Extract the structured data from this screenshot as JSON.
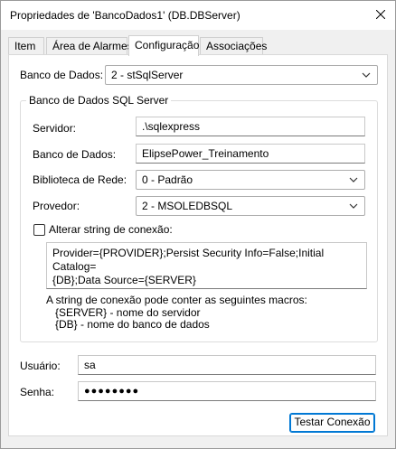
{
  "window": {
    "title": "Propriedades de 'BancoDados1' (DB.DBServer)"
  },
  "tabs": [
    {
      "label": "Item"
    },
    {
      "label": "Área de Alarmes"
    },
    {
      "label": "Configuração"
    },
    {
      "label": "Associações"
    }
  ],
  "active_tab": "Configuração",
  "form": {
    "database_label": "Banco de Dados:",
    "database_value": "2 - stSqlServer",
    "group_title": "Banco de Dados SQL Server",
    "server_label": "Servidor:",
    "server_value": ".\\sqlexpress",
    "dbname_label": "Banco de Dados:",
    "dbname_value": "ElipsePower_Treinamento",
    "netlib_label": "Biblioteca de Rede:",
    "netlib_value": "0 - Padrão",
    "provider_label": "Provedor:",
    "provider_value": "2 - MSOLEDBSQL",
    "alter_conn_label": "Alterar string de conexão:",
    "alter_conn_checked": false,
    "conn_string_line1": "Provider={PROVIDER};Persist Security Info=False;Initial Catalog=",
    "conn_string_line2": "{DB};Data Source={SERVER}",
    "macros_intro": "A string de conexão pode conter as seguintes macros:",
    "macro_server": "{SERVER} - nome do servidor",
    "macro_db": "{DB} - nome do banco de dados",
    "user_label": "Usuário:",
    "user_value": "sa",
    "password_label": "Senha:",
    "password_value": "●●●●●●●●",
    "test_button": "Testar Conexão"
  },
  "icons": {
    "close": "close-icon",
    "dropdown": "chevron-down-icon"
  },
  "colors": {
    "accent": "#0078d4",
    "panel_bg": "#ffffff",
    "window_bg": "#f0f0f0"
  }
}
